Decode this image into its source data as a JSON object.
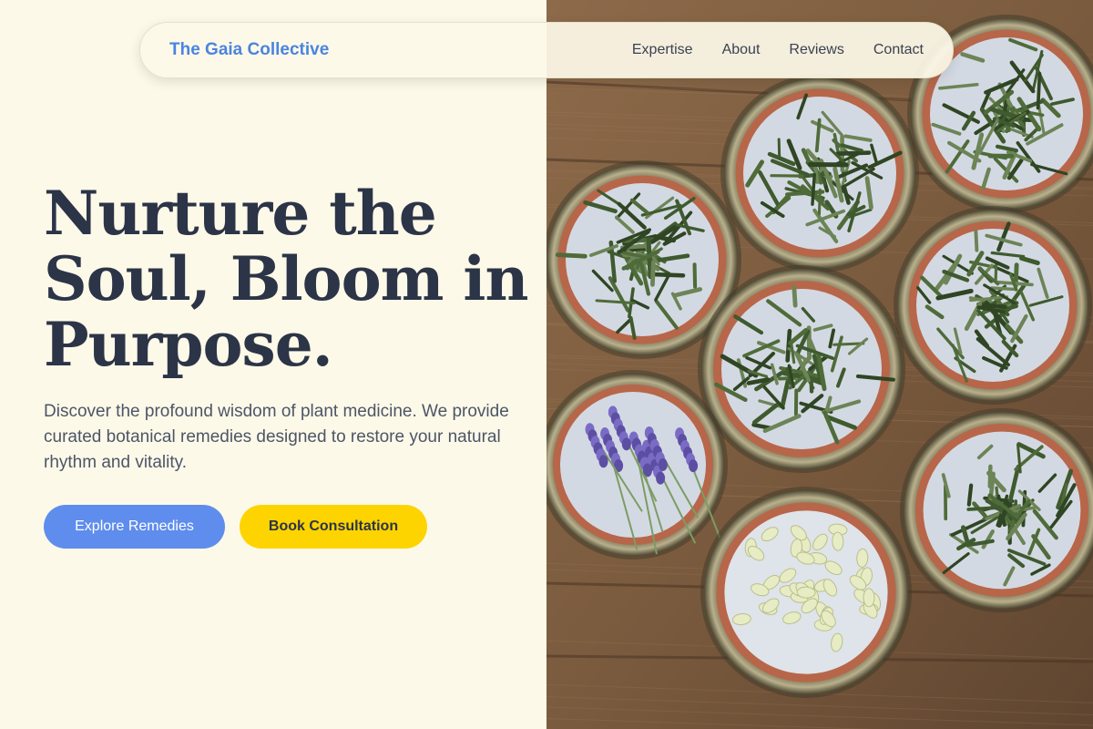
{
  "nav": {
    "brand": "The Gaia Collective",
    "links": [
      "Expertise",
      "About",
      "Reviews",
      "Contact"
    ]
  },
  "hero": {
    "title_lines": [
      "Nurture the",
      "Soul, Bloom in",
      "Purpose."
    ],
    "description": "Discover the profound wisdom of plant medicine. We provide curated botanical remedies designed to restore your natural rhythm and vitality.",
    "primary_button": "Explore Remedies",
    "secondary_button": "Book Consultation"
  },
  "colors": {
    "background": "#fdf9e8",
    "brand": "#4b84e0",
    "heading": "#2c3447",
    "primary_button": "#5f8ded",
    "secondary_button": "#fdd400"
  }
}
